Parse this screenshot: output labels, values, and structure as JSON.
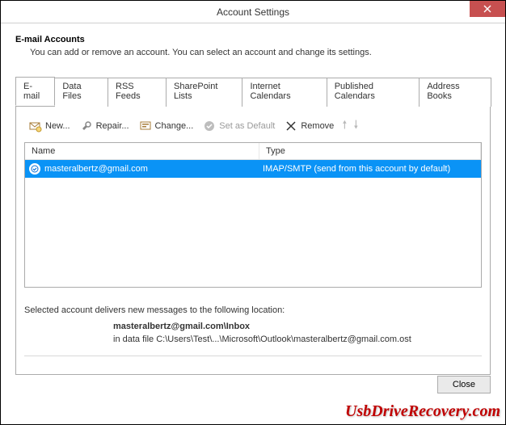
{
  "titlebar": {
    "title": "Account Settings"
  },
  "header": {
    "heading": "E-mail Accounts",
    "sub": "You can add or remove an account. You can select an account and change its settings."
  },
  "tabs": {
    "items": [
      {
        "label": "E-mail"
      },
      {
        "label": "Data Files"
      },
      {
        "label": "RSS Feeds"
      },
      {
        "label": "SharePoint Lists"
      },
      {
        "label": "Internet Calendars"
      },
      {
        "label": "Published Calendars"
      },
      {
        "label": "Address Books"
      }
    ]
  },
  "toolbar": {
    "new": "New...",
    "repair": "Repair...",
    "change": "Change...",
    "setdefault": "Set as Default",
    "remove": "Remove"
  },
  "list": {
    "col_name": "Name",
    "col_type": "Type",
    "rows": [
      {
        "name": "masteralbertz@gmail.com",
        "type": "IMAP/SMTP (send from this account by default)"
      }
    ]
  },
  "info": {
    "line1": "Selected account delivers new messages to the following location:",
    "line2": "masteralbertz@gmail.com\\Inbox",
    "line3": "in data file C:\\Users\\Test\\...\\Microsoft\\Outlook\\masteralbertz@gmail.com.ost"
  },
  "footer": {
    "close": "Close"
  },
  "watermark": "UsbDriveRecovery.com"
}
